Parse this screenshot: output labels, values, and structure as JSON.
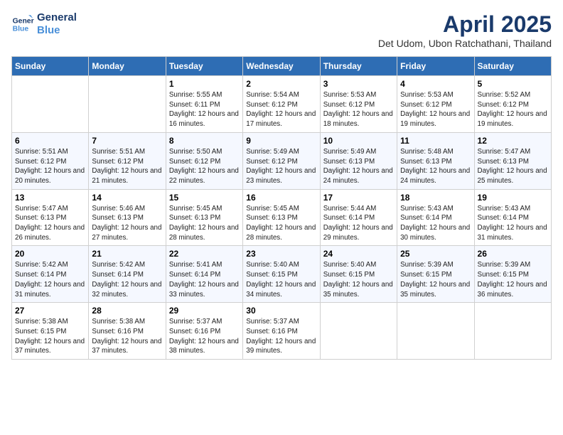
{
  "header": {
    "logo_line1": "General",
    "logo_line2": "Blue",
    "month": "April 2025",
    "location": "Det Udom, Ubon Ratchathani, Thailand"
  },
  "weekdays": [
    "Sunday",
    "Monday",
    "Tuesday",
    "Wednesday",
    "Thursday",
    "Friday",
    "Saturday"
  ],
  "weeks": [
    [
      {
        "day": "",
        "info": ""
      },
      {
        "day": "",
        "info": ""
      },
      {
        "day": "1",
        "info": "Sunrise: 5:55 AM\nSunset: 6:11 PM\nDaylight: 12 hours and 16 minutes."
      },
      {
        "day": "2",
        "info": "Sunrise: 5:54 AM\nSunset: 6:12 PM\nDaylight: 12 hours and 17 minutes."
      },
      {
        "day": "3",
        "info": "Sunrise: 5:53 AM\nSunset: 6:12 PM\nDaylight: 12 hours and 18 minutes."
      },
      {
        "day": "4",
        "info": "Sunrise: 5:53 AM\nSunset: 6:12 PM\nDaylight: 12 hours and 19 minutes."
      },
      {
        "day": "5",
        "info": "Sunrise: 5:52 AM\nSunset: 6:12 PM\nDaylight: 12 hours and 19 minutes."
      }
    ],
    [
      {
        "day": "6",
        "info": "Sunrise: 5:51 AM\nSunset: 6:12 PM\nDaylight: 12 hours and 20 minutes."
      },
      {
        "day": "7",
        "info": "Sunrise: 5:51 AM\nSunset: 6:12 PM\nDaylight: 12 hours and 21 minutes."
      },
      {
        "day": "8",
        "info": "Sunrise: 5:50 AM\nSunset: 6:12 PM\nDaylight: 12 hours and 22 minutes."
      },
      {
        "day": "9",
        "info": "Sunrise: 5:49 AM\nSunset: 6:12 PM\nDaylight: 12 hours and 23 minutes."
      },
      {
        "day": "10",
        "info": "Sunrise: 5:49 AM\nSunset: 6:13 PM\nDaylight: 12 hours and 24 minutes."
      },
      {
        "day": "11",
        "info": "Sunrise: 5:48 AM\nSunset: 6:13 PM\nDaylight: 12 hours and 24 minutes."
      },
      {
        "day": "12",
        "info": "Sunrise: 5:47 AM\nSunset: 6:13 PM\nDaylight: 12 hours and 25 minutes."
      }
    ],
    [
      {
        "day": "13",
        "info": "Sunrise: 5:47 AM\nSunset: 6:13 PM\nDaylight: 12 hours and 26 minutes."
      },
      {
        "day": "14",
        "info": "Sunrise: 5:46 AM\nSunset: 6:13 PM\nDaylight: 12 hours and 27 minutes."
      },
      {
        "day": "15",
        "info": "Sunrise: 5:45 AM\nSunset: 6:13 PM\nDaylight: 12 hours and 28 minutes."
      },
      {
        "day": "16",
        "info": "Sunrise: 5:45 AM\nSunset: 6:13 PM\nDaylight: 12 hours and 28 minutes."
      },
      {
        "day": "17",
        "info": "Sunrise: 5:44 AM\nSunset: 6:14 PM\nDaylight: 12 hours and 29 minutes."
      },
      {
        "day": "18",
        "info": "Sunrise: 5:43 AM\nSunset: 6:14 PM\nDaylight: 12 hours and 30 minutes."
      },
      {
        "day": "19",
        "info": "Sunrise: 5:43 AM\nSunset: 6:14 PM\nDaylight: 12 hours and 31 minutes."
      }
    ],
    [
      {
        "day": "20",
        "info": "Sunrise: 5:42 AM\nSunset: 6:14 PM\nDaylight: 12 hours and 31 minutes."
      },
      {
        "day": "21",
        "info": "Sunrise: 5:42 AM\nSunset: 6:14 PM\nDaylight: 12 hours and 32 minutes."
      },
      {
        "day": "22",
        "info": "Sunrise: 5:41 AM\nSunset: 6:14 PM\nDaylight: 12 hours and 33 minutes."
      },
      {
        "day": "23",
        "info": "Sunrise: 5:40 AM\nSunset: 6:15 PM\nDaylight: 12 hours and 34 minutes."
      },
      {
        "day": "24",
        "info": "Sunrise: 5:40 AM\nSunset: 6:15 PM\nDaylight: 12 hours and 35 minutes."
      },
      {
        "day": "25",
        "info": "Sunrise: 5:39 AM\nSunset: 6:15 PM\nDaylight: 12 hours and 35 minutes."
      },
      {
        "day": "26",
        "info": "Sunrise: 5:39 AM\nSunset: 6:15 PM\nDaylight: 12 hours and 36 minutes."
      }
    ],
    [
      {
        "day": "27",
        "info": "Sunrise: 5:38 AM\nSunset: 6:15 PM\nDaylight: 12 hours and 37 minutes."
      },
      {
        "day": "28",
        "info": "Sunrise: 5:38 AM\nSunset: 6:16 PM\nDaylight: 12 hours and 37 minutes."
      },
      {
        "day": "29",
        "info": "Sunrise: 5:37 AM\nSunset: 6:16 PM\nDaylight: 12 hours and 38 minutes."
      },
      {
        "day": "30",
        "info": "Sunrise: 5:37 AM\nSunset: 6:16 PM\nDaylight: 12 hours and 39 minutes."
      },
      {
        "day": "",
        "info": ""
      },
      {
        "day": "",
        "info": ""
      },
      {
        "day": "",
        "info": ""
      }
    ]
  ]
}
